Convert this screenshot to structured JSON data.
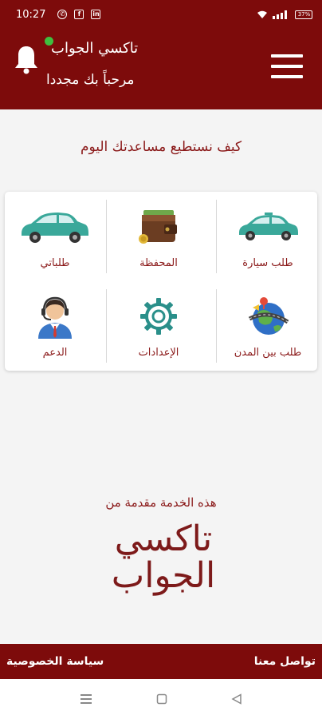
{
  "status": {
    "time": "10:27",
    "battery": "37%"
  },
  "header": {
    "app_name": "تاكسي الجواب",
    "welcome": "مرحباً بك مجددا"
  },
  "main": {
    "question": "كيف نستطيع مساعدتك اليوم",
    "tiles": [
      {
        "label": "طلب سيارة",
        "icon": "taxi-car-icon"
      },
      {
        "label": "المحفظة",
        "icon": "wallet-icon"
      },
      {
        "label": "طلباتي",
        "icon": "my-orders-car-icon"
      },
      {
        "label": "طلب بين المدن",
        "icon": "globe-intercity-icon"
      },
      {
        "label": "الإعدادات",
        "icon": "settings-gear-icon"
      },
      {
        "label": "الدعم",
        "icon": "support-agent-icon"
      }
    ],
    "service_note": "هذه الخدمة مقدمة من",
    "brand_line1": "تاكسي",
    "brand_line2": "الجواب"
  },
  "footer": {
    "contact": "تواصل معنا",
    "privacy": "سياسة الخصوصية"
  },
  "colors": {
    "primary": "#7d0b0b",
    "accent_text": "#8b1a1a",
    "taxi_teal": "#3aa89a"
  }
}
